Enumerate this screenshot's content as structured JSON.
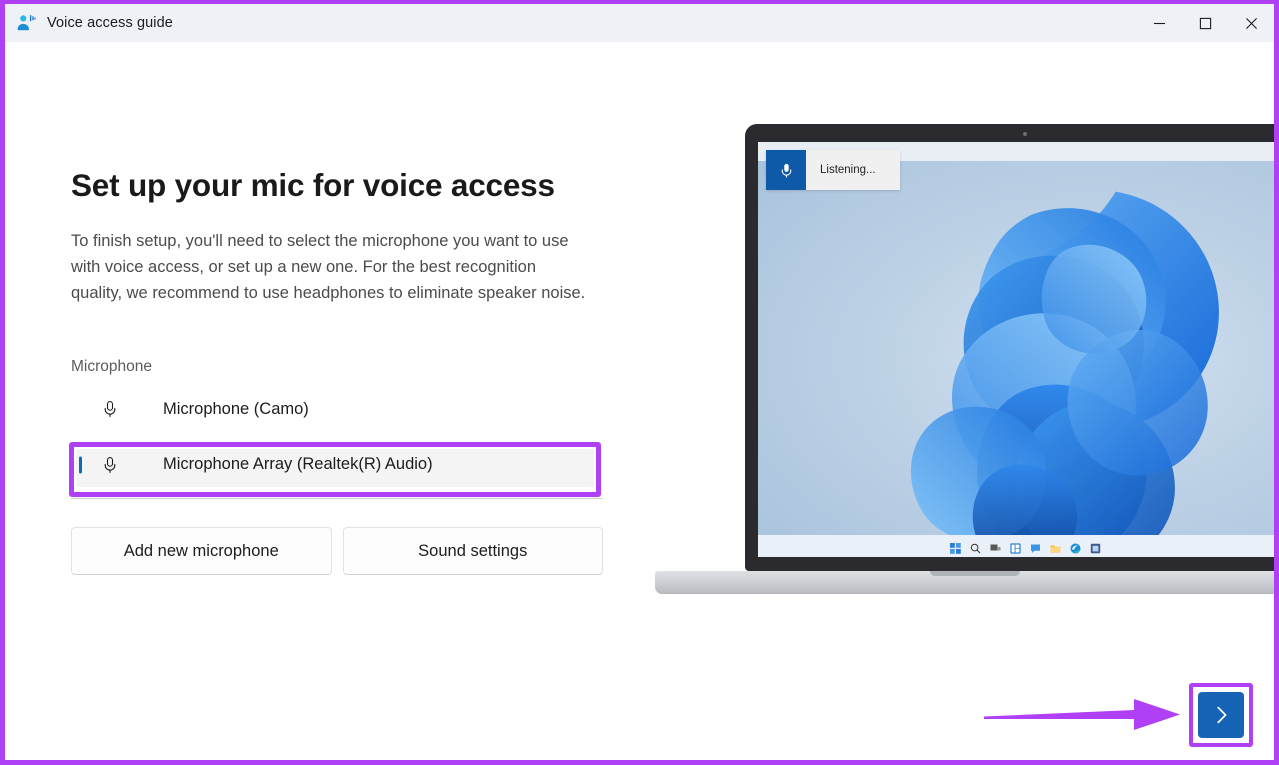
{
  "window": {
    "title": "Voice access guide",
    "app_icon": "voice-access-person-icon",
    "controls": {
      "minimize": "minimize-icon",
      "maximize": "maximize-icon",
      "close": "close-icon"
    }
  },
  "main": {
    "heading": "Set up your mic for voice access",
    "description": "To finish setup, you'll need to select the microphone you want to use with voice access, or set up a new one. For the best recognition quality, we recommend to use headphones to eliminate speaker noise.",
    "section_label": "Microphone",
    "microphones": [
      {
        "label": "Microphone (Camo)",
        "selected": false,
        "icon": "microphone-icon"
      },
      {
        "label": "Microphone Array (Realtek(R) Audio)",
        "selected": true,
        "icon": "microphone-icon"
      }
    ],
    "buttons": {
      "add_new": "Add new microphone",
      "sound_settings": "Sound settings"
    },
    "next_label": "chevron-right-icon"
  },
  "illustration": {
    "voice_access_bar": {
      "status": "Listening...",
      "mic_icon": "microphone-filled-icon"
    },
    "taskbar_icons": [
      "start-icon",
      "search-icon",
      "task-view-icon",
      "widgets-icon",
      "chat-icon",
      "file-explorer-icon",
      "edge-icon",
      "store-icon"
    ]
  },
  "annotations": {
    "highlight_color": "#b040f5",
    "arrow": "right-arrow-annotation",
    "highlighted_items": [
      "microphone-array-realtek-row",
      "next-button",
      "window-frame"
    ]
  },
  "colors": {
    "accent_blue": "#0f6cbd",
    "next_button_blue": "#1763b5",
    "titlebar": "#eef2f7",
    "annotation_purple": "#b040f5"
  }
}
